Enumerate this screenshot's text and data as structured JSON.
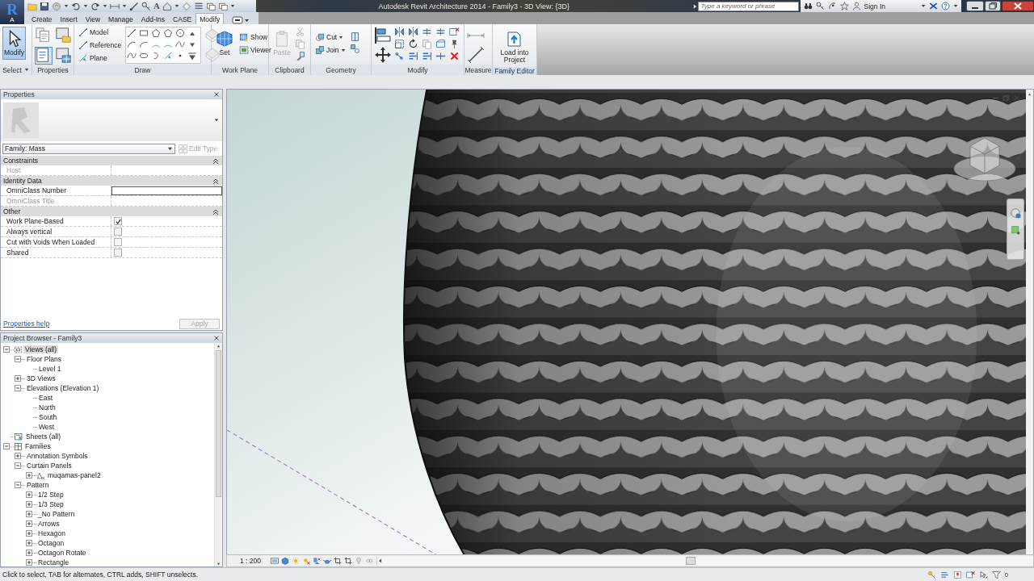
{
  "title_bar": {
    "logo": "R",
    "logo_sub": "A",
    "text_tool": "A",
    "title": "Autodesk Revit Architecture 2014 - Family3 - 3D View: {3D}",
    "search": {
      "placeholder": "Type a keyword or phrase"
    },
    "sign_in": "Sign In"
  },
  "ribbon": {
    "tabs": [
      {
        "label": "Create",
        "selected": false
      },
      {
        "label": "Insert",
        "selected": false
      },
      {
        "label": "View",
        "selected": false
      },
      {
        "label": "Manage",
        "selected": false
      },
      {
        "label": "Add-Ins",
        "selected": false
      },
      {
        "label": "CASE",
        "selected": false
      },
      {
        "label": "Modify",
        "selected": true
      }
    ],
    "panels": [
      {
        "kind": "select",
        "label": "Select",
        "menu": true,
        "contextual": false,
        "buttons": [
          {
            "label": "Modify",
            "kind": "large",
            "selected": true,
            "disabled": false
          }
        ]
      },
      {
        "kind": "properties",
        "label": "Properties",
        "menu": false,
        "contextual": false,
        "buttons": [
          {
            "kind": "icon",
            "selected": false,
            "disabled": false
          },
          {
            "kind": "icon",
            "selected": false,
            "disabled": false
          },
          {
            "kind": "icon",
            "selected": true,
            "disabled": false
          },
          {
            "kind": "icon",
            "selected": false,
            "disabled": false
          }
        ]
      },
      {
        "kind": "draw",
        "label": "Draw",
        "menu": false,
        "contextual": false,
        "buttons": [
          {
            "label": "Model",
            "kind": "small",
            "selected": false,
            "disabled": false
          },
          {
            "label": "Reference",
            "kind": "small",
            "selected": false,
            "disabled": false
          },
          {
            "label": "Plane",
            "kind": "small",
            "selected": false,
            "disabled": false
          }
        ]
      },
      {
        "kind": "workplane",
        "label": "Work Plane",
        "menu": false,
        "contextual": false,
        "buttons": [
          {
            "label": "Set",
            "kind": "large",
            "selected": false,
            "disabled": false
          },
          {
            "label": "Show",
            "kind": "small",
            "selected": false,
            "disabled": false
          },
          {
            "label": "Viewer",
            "kind": "small",
            "selected": false,
            "disabled": false
          }
        ]
      },
      {
        "kind": "clipboard",
        "label": "Clipboard",
        "menu": false,
        "contextual": false,
        "buttons": [
          {
            "label": "Paste",
            "kind": "large",
            "selected": false,
            "disabled": true
          }
        ]
      },
      {
        "kind": "geometry",
        "label": "Geometry",
        "menu": false,
        "contextual": false,
        "buttons": [
          {
            "label": "Cut",
            "kind": "split",
            "selected": false,
            "disabled": false
          },
          {
            "label": "Join",
            "kind": "split",
            "selected": false,
            "disabled": false
          }
        ]
      },
      {
        "kind": "modify",
        "label": "Modify",
        "menu": false,
        "contextual": false
      },
      {
        "kind": "measure",
        "label": "Measure",
        "menu": false,
        "contextual": false
      },
      {
        "kind": "family",
        "label": "Family Editor",
        "menu": false,
        "contextual": true,
        "buttons": [
          {
            "label": "Load into Project",
            "kind": "large",
            "selected": false,
            "disabled": false
          }
        ]
      }
    ]
  },
  "properties": {
    "title": "Properties",
    "type_selector": "Family: Mass",
    "edit_type": {
      "label": "Edit Type",
      "disabled": true
    },
    "groups": [
      {
        "label": "Constraints",
        "expanded": true,
        "rows": [
          {
            "label": "Host",
            "kind": "text",
            "disabled": true
          }
        ]
      },
      {
        "label": "Identity Data",
        "expanded": true,
        "rows": [
          {
            "label": "OmniClass Number",
            "kind": "input",
            "disabled": false
          },
          {
            "label": "OmniClass Title",
            "kind": "text",
            "disabled": true
          }
        ]
      },
      {
        "label": "Other",
        "expanded": true,
        "rows": [
          {
            "label": "Work Plane-Based",
            "kind": "checkbox",
            "checked": true,
            "disabled": false
          },
          {
            "label": "Always vertical",
            "kind": "checkbox",
            "checked": false,
            "disabled": false
          },
          {
            "label": "Cut with Voids When Loaded",
            "kind": "checkbox",
            "checked": false,
            "disabled": false
          },
          {
            "label": "Shared",
            "kind": "checkbox",
            "checked": false,
            "disabled": false
          }
        ]
      }
    ],
    "help_link": "Properties help",
    "apply": {
      "label": "Apply",
      "disabled": true
    }
  },
  "project_browser": {
    "title": "Project Browser - Family3",
    "tree": [
      {
        "label": "Views (all)",
        "kind": "views",
        "expanded": true,
        "selected": true,
        "children": [
          {
            "label": "Floor Plans",
            "expanded": true,
            "selected": false,
            "children": [
              {
                "label": "Level 1",
                "selected": false
              }
            ]
          },
          {
            "label": "3D Views",
            "expanded": false,
            "selected": false
          },
          {
            "label": "Elevations (Elevation 1)",
            "expanded": true,
            "selected": false,
            "children": [
              {
                "label": "East",
                "selected": false
              },
              {
                "label": "North",
                "selected": false
              },
              {
                "label": "South",
                "selected": false
              },
              {
                "label": "West",
                "selected": false
              }
            ]
          }
        ]
      },
      {
        "label": "Sheets (all)",
        "kind": "sheets",
        "selected": false
      },
      {
        "label": "Families",
        "kind": "families",
        "expanded": true,
        "selected": false,
        "children": [
          {
            "label": "Annotation Symbols",
            "expanded": false,
            "selected": false
          },
          {
            "label": "Curtain Panels",
            "expanded": true,
            "selected": false,
            "children": [
              {
                "label": "muqamas-panel2",
                "kind": "family",
                "expanded": false,
                "selected": false
              }
            ]
          },
          {
            "label": "Pattern",
            "expanded": true,
            "selected": false,
            "children": [
              {
                "label": "1/2 Step",
                "expanded": false,
                "selected": false
              },
              {
                "label": "1/3 Step",
                "expanded": false,
                "selected": false
              },
              {
                "label": "_No Pattern",
                "expanded": false,
                "selected": false
              },
              {
                "label": "Arrows",
                "expanded": false,
                "selected": false
              },
              {
                "label": "Hexagon",
                "expanded": false,
                "selected": false
              },
              {
                "label": "Octagon",
                "expanded": false,
                "selected": false
              },
              {
                "label": "Octagon Rotate",
                "expanded": false,
                "selected": false
              },
              {
                "label": "Rectangle",
                "expanded": false,
                "selected": false
              }
            ]
          }
        ]
      }
    ]
  },
  "view_control_bar": {
    "scale": "1 : 200"
  },
  "status_bar": {
    "message": "Click to select, TAB for alternates, CTRL adds, SHIFT unselects.",
    "filter_count": "0"
  }
}
